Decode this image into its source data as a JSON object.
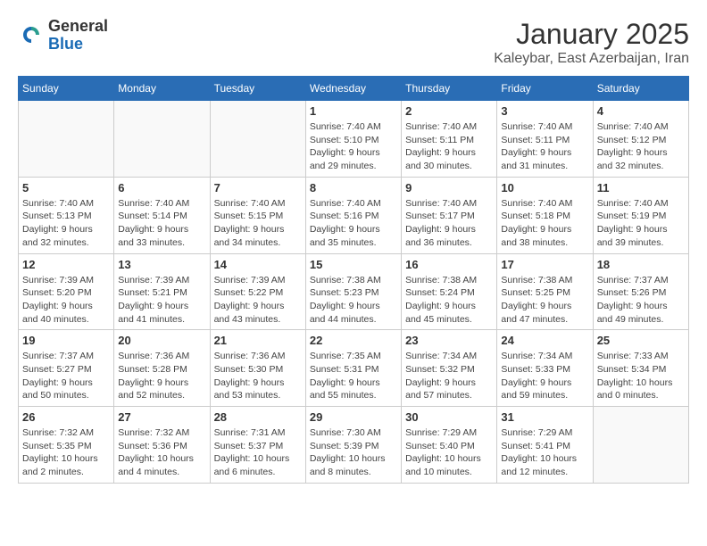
{
  "logo": {
    "general": "General",
    "blue": "Blue"
  },
  "header": {
    "title": "January 2025",
    "subtitle": "Kaleybar, East Azerbaijan, Iran"
  },
  "weekdays": [
    "Sunday",
    "Monday",
    "Tuesday",
    "Wednesday",
    "Thursday",
    "Friday",
    "Saturday"
  ],
  "weeks": [
    [
      {
        "day": "",
        "info": ""
      },
      {
        "day": "",
        "info": ""
      },
      {
        "day": "",
        "info": ""
      },
      {
        "day": "1",
        "info": "Sunrise: 7:40 AM\nSunset: 5:10 PM\nDaylight: 9 hours and 29 minutes."
      },
      {
        "day": "2",
        "info": "Sunrise: 7:40 AM\nSunset: 5:11 PM\nDaylight: 9 hours and 30 minutes."
      },
      {
        "day": "3",
        "info": "Sunrise: 7:40 AM\nSunset: 5:11 PM\nDaylight: 9 hours and 31 minutes."
      },
      {
        "day": "4",
        "info": "Sunrise: 7:40 AM\nSunset: 5:12 PM\nDaylight: 9 hours and 32 minutes."
      }
    ],
    [
      {
        "day": "5",
        "info": "Sunrise: 7:40 AM\nSunset: 5:13 PM\nDaylight: 9 hours and 32 minutes."
      },
      {
        "day": "6",
        "info": "Sunrise: 7:40 AM\nSunset: 5:14 PM\nDaylight: 9 hours and 33 minutes."
      },
      {
        "day": "7",
        "info": "Sunrise: 7:40 AM\nSunset: 5:15 PM\nDaylight: 9 hours and 34 minutes."
      },
      {
        "day": "8",
        "info": "Sunrise: 7:40 AM\nSunset: 5:16 PM\nDaylight: 9 hours and 35 minutes."
      },
      {
        "day": "9",
        "info": "Sunrise: 7:40 AM\nSunset: 5:17 PM\nDaylight: 9 hours and 36 minutes."
      },
      {
        "day": "10",
        "info": "Sunrise: 7:40 AM\nSunset: 5:18 PM\nDaylight: 9 hours and 38 minutes."
      },
      {
        "day": "11",
        "info": "Sunrise: 7:40 AM\nSunset: 5:19 PM\nDaylight: 9 hours and 39 minutes."
      }
    ],
    [
      {
        "day": "12",
        "info": "Sunrise: 7:39 AM\nSunset: 5:20 PM\nDaylight: 9 hours and 40 minutes."
      },
      {
        "day": "13",
        "info": "Sunrise: 7:39 AM\nSunset: 5:21 PM\nDaylight: 9 hours and 41 minutes."
      },
      {
        "day": "14",
        "info": "Sunrise: 7:39 AM\nSunset: 5:22 PM\nDaylight: 9 hours and 43 minutes."
      },
      {
        "day": "15",
        "info": "Sunrise: 7:38 AM\nSunset: 5:23 PM\nDaylight: 9 hours and 44 minutes."
      },
      {
        "day": "16",
        "info": "Sunrise: 7:38 AM\nSunset: 5:24 PM\nDaylight: 9 hours and 45 minutes."
      },
      {
        "day": "17",
        "info": "Sunrise: 7:38 AM\nSunset: 5:25 PM\nDaylight: 9 hours and 47 minutes."
      },
      {
        "day": "18",
        "info": "Sunrise: 7:37 AM\nSunset: 5:26 PM\nDaylight: 9 hours and 49 minutes."
      }
    ],
    [
      {
        "day": "19",
        "info": "Sunrise: 7:37 AM\nSunset: 5:27 PM\nDaylight: 9 hours and 50 minutes."
      },
      {
        "day": "20",
        "info": "Sunrise: 7:36 AM\nSunset: 5:28 PM\nDaylight: 9 hours and 52 minutes."
      },
      {
        "day": "21",
        "info": "Sunrise: 7:36 AM\nSunset: 5:30 PM\nDaylight: 9 hours and 53 minutes."
      },
      {
        "day": "22",
        "info": "Sunrise: 7:35 AM\nSunset: 5:31 PM\nDaylight: 9 hours and 55 minutes."
      },
      {
        "day": "23",
        "info": "Sunrise: 7:34 AM\nSunset: 5:32 PM\nDaylight: 9 hours and 57 minutes."
      },
      {
        "day": "24",
        "info": "Sunrise: 7:34 AM\nSunset: 5:33 PM\nDaylight: 9 hours and 59 minutes."
      },
      {
        "day": "25",
        "info": "Sunrise: 7:33 AM\nSunset: 5:34 PM\nDaylight: 10 hours and 0 minutes."
      }
    ],
    [
      {
        "day": "26",
        "info": "Sunrise: 7:32 AM\nSunset: 5:35 PM\nDaylight: 10 hours and 2 minutes."
      },
      {
        "day": "27",
        "info": "Sunrise: 7:32 AM\nSunset: 5:36 PM\nDaylight: 10 hours and 4 minutes."
      },
      {
        "day": "28",
        "info": "Sunrise: 7:31 AM\nSunset: 5:37 PM\nDaylight: 10 hours and 6 minutes."
      },
      {
        "day": "29",
        "info": "Sunrise: 7:30 AM\nSunset: 5:39 PM\nDaylight: 10 hours and 8 minutes."
      },
      {
        "day": "30",
        "info": "Sunrise: 7:29 AM\nSunset: 5:40 PM\nDaylight: 10 hours and 10 minutes."
      },
      {
        "day": "31",
        "info": "Sunrise: 7:29 AM\nSunset: 5:41 PM\nDaylight: 10 hours and 12 minutes."
      },
      {
        "day": "",
        "info": ""
      }
    ]
  ]
}
